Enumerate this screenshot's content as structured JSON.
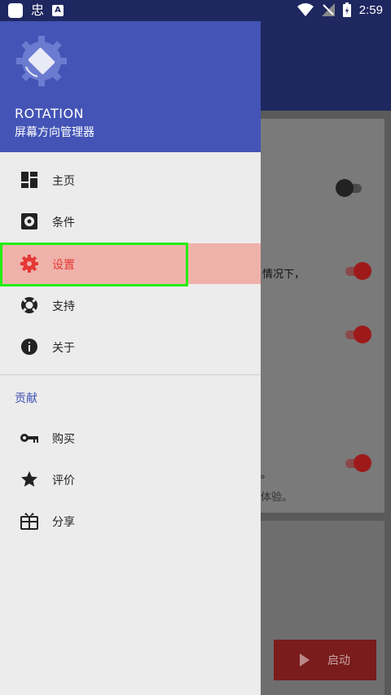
{
  "status_bar": {
    "time": "2:59",
    "icon_left_glyph": "忠",
    "icon_a": "A"
  },
  "drawer": {
    "app_name": "ROTATION",
    "app_subtitle": "屏幕方向管理器",
    "items": [
      {
        "label": "主页",
        "icon": "dashboard-icon"
      },
      {
        "label": "条件",
        "icon": "conditions-gear-icon"
      },
      {
        "label": "设置",
        "icon": "settings-gear-icon",
        "selected": true
      },
      {
        "label": "支持",
        "icon": "lifebuoy-icon"
      },
      {
        "label": "关于",
        "icon": "info-icon"
      }
    ],
    "section_title": "贡献",
    "section_items": [
      {
        "label": "购买",
        "icon": "key-icon"
      },
      {
        "label": "评价",
        "icon": "star-icon"
      },
      {
        "label": "分享",
        "icon": "gift-icon"
      }
    ]
  },
  "background": {
    "text1": "情况下，",
    "text2": "。",
    "text3": "体验。",
    "start_button": "启动"
  },
  "colors": {
    "primary": "#4354b6",
    "primary_dark": "#1e2760",
    "accent": "#e53935",
    "selected_bg": "#efb2aa",
    "highlight": "#22ee11"
  }
}
